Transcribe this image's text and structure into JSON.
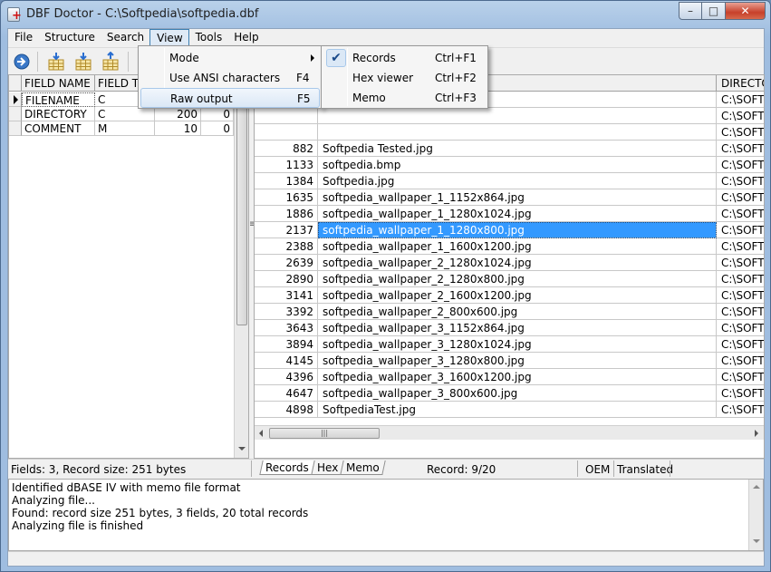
{
  "window": {
    "title": "DBF Doctor - C:\\Softpedia\\softpedia.dbf",
    "min_glyph": "–",
    "max_glyph": "□",
    "close_glyph": "✕"
  },
  "menubar": [
    "File",
    "Structure",
    "Search",
    "View",
    "Tools",
    "Help"
  ],
  "view_menu": {
    "items": [
      {
        "label": "Mode",
        "shortcut": "",
        "submenu": true
      },
      {
        "label": "Use ANSI characters",
        "shortcut": "F4"
      },
      {
        "label": "Raw output",
        "shortcut": "F5"
      }
    ]
  },
  "mode_submenu": {
    "check_glyph": "✔",
    "items": [
      {
        "label": "Records",
        "shortcut": "Ctrl+F1",
        "checked": true
      },
      {
        "label": "Hex viewer",
        "shortcut": "Ctrl+F2",
        "checked": false
      },
      {
        "label": "Memo",
        "shortcut": "Ctrl+F3",
        "checked": false
      }
    ]
  },
  "fields_grid": {
    "columns": [
      "FIELD NAME",
      "FIELD TY",
      "",
      ""
    ],
    "rows": [
      [
        "FILENAME",
        "C",
        "",
        ""
      ],
      [
        "DIRECTORY",
        "C",
        "200",
        "0"
      ],
      [
        "COMMENT",
        "M",
        "10",
        "0"
      ]
    ]
  },
  "records_grid": {
    "right_header": "DIRECTO",
    "selected_index": 7,
    "rows": [
      {
        "id": "",
        "name": "",
        "dir": "C:\\SOFTP"
      },
      {
        "id": "",
        "name": "",
        "dir": "C:\\SOFTP"
      },
      {
        "id": "",
        "name": "",
        "dir": "C:\\SOFTP"
      },
      {
        "id": "882",
        "name": "Softpedia Tested.jpg",
        "dir": "C:\\SOFTP"
      },
      {
        "id": "1133",
        "name": "softpedia.bmp",
        "dir": "C:\\SOFTP"
      },
      {
        "id": "1384",
        "name": "Softpedia.jpg",
        "dir": "C:\\SOFTP"
      },
      {
        "id": "1635",
        "name": "softpedia_wallpaper_1_1152x864.jpg",
        "dir": "C:\\SOFTP"
      },
      {
        "id": "1886",
        "name": "softpedia_wallpaper_1_1280x1024.jpg",
        "dir": "C:\\SOFTP"
      },
      {
        "id": "2137",
        "name": "softpedia_wallpaper_1_1280x800.jpg",
        "dir": "C:\\SOFTP"
      },
      {
        "id": "2388",
        "name": "softpedia_wallpaper_1_1600x1200.jpg",
        "dir": "C:\\SOFTP"
      },
      {
        "id": "2639",
        "name": "softpedia_wallpaper_2_1280x1024.jpg",
        "dir": "C:\\SOFTP"
      },
      {
        "id": "2890",
        "name": "softpedia_wallpaper_2_1280x800.jpg",
        "dir": "C:\\SOFTP"
      },
      {
        "id": "3141",
        "name": "softpedia_wallpaper_2_1600x1200.jpg",
        "dir": "C:\\SOFTP"
      },
      {
        "id": "3392",
        "name": "softpedia_wallpaper_2_800x600.jpg",
        "dir": "C:\\SOFTP"
      },
      {
        "id": "3643",
        "name": "softpedia_wallpaper_3_1152x864.jpg",
        "dir": "C:\\SOFTP"
      },
      {
        "id": "3894",
        "name": "softpedia_wallpaper_3_1280x1024.jpg",
        "dir": "C:\\SOFTP"
      },
      {
        "id": "4145",
        "name": "softpedia_wallpaper_3_1280x800.jpg",
        "dir": "C:\\SOFTP"
      },
      {
        "id": "4396",
        "name": "softpedia_wallpaper_3_1600x1200.jpg",
        "dir": "C:\\SOFTP"
      },
      {
        "id": "4647",
        "name": "softpedia_wallpaper_3_800x600.jpg",
        "dir": "C:\\SOFTP"
      },
      {
        "id": "4898",
        "name": "SoftpediaTest.jpg",
        "dir": "C:\\SOFTP"
      }
    ]
  },
  "statusbar": {
    "fields_info": "Fields: 3, Record size: 251 bytes",
    "tabs": [
      "Records",
      "Hex",
      "Memo"
    ],
    "record": "Record: 9/20",
    "encoding": "OEM",
    "mode": "Translated"
  },
  "log": [
    "Identified dBASE IV with memo file format",
    "Analyzing file...",
    "Found: record size 251 bytes, 3 fields, 20 total records",
    "Analyzing file is finished"
  ],
  "splitter_grip": "≡",
  "hscroll_grip": "|||",
  "colors": {
    "selection": "#3399ff",
    "title_bar": "#b9d1ea",
    "close_button": "#c7402a"
  },
  "icons": [
    "database-icon",
    "exit-icon",
    "field-insert-icon",
    "field-add-icon",
    "field-delete-icon",
    "check-icon"
  ]
}
